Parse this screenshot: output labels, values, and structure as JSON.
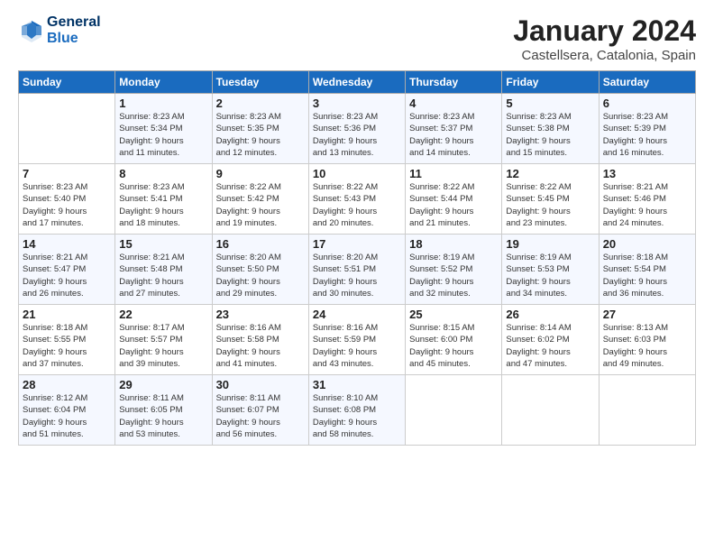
{
  "header": {
    "logo_line1": "General",
    "logo_line2": "Blue",
    "title": "January 2024",
    "subtitle": "Castellsera, Catalonia, Spain"
  },
  "days_of_week": [
    "Sunday",
    "Monday",
    "Tuesday",
    "Wednesday",
    "Thursday",
    "Friday",
    "Saturday"
  ],
  "weeks": [
    [
      {
        "day": "",
        "info": ""
      },
      {
        "day": "1",
        "info": "Sunrise: 8:23 AM\nSunset: 5:34 PM\nDaylight: 9 hours\nand 11 minutes."
      },
      {
        "day": "2",
        "info": "Sunrise: 8:23 AM\nSunset: 5:35 PM\nDaylight: 9 hours\nand 12 minutes."
      },
      {
        "day": "3",
        "info": "Sunrise: 8:23 AM\nSunset: 5:36 PM\nDaylight: 9 hours\nand 13 minutes."
      },
      {
        "day": "4",
        "info": "Sunrise: 8:23 AM\nSunset: 5:37 PM\nDaylight: 9 hours\nand 14 minutes."
      },
      {
        "day": "5",
        "info": "Sunrise: 8:23 AM\nSunset: 5:38 PM\nDaylight: 9 hours\nand 15 minutes."
      },
      {
        "day": "6",
        "info": "Sunrise: 8:23 AM\nSunset: 5:39 PM\nDaylight: 9 hours\nand 16 minutes."
      }
    ],
    [
      {
        "day": "7",
        "info": "Sunrise: 8:23 AM\nSunset: 5:40 PM\nDaylight: 9 hours\nand 17 minutes."
      },
      {
        "day": "8",
        "info": "Sunrise: 8:23 AM\nSunset: 5:41 PM\nDaylight: 9 hours\nand 18 minutes."
      },
      {
        "day": "9",
        "info": "Sunrise: 8:22 AM\nSunset: 5:42 PM\nDaylight: 9 hours\nand 19 minutes."
      },
      {
        "day": "10",
        "info": "Sunrise: 8:22 AM\nSunset: 5:43 PM\nDaylight: 9 hours\nand 20 minutes."
      },
      {
        "day": "11",
        "info": "Sunrise: 8:22 AM\nSunset: 5:44 PM\nDaylight: 9 hours\nand 21 minutes."
      },
      {
        "day": "12",
        "info": "Sunrise: 8:22 AM\nSunset: 5:45 PM\nDaylight: 9 hours\nand 23 minutes."
      },
      {
        "day": "13",
        "info": "Sunrise: 8:21 AM\nSunset: 5:46 PM\nDaylight: 9 hours\nand 24 minutes."
      }
    ],
    [
      {
        "day": "14",
        "info": "Sunrise: 8:21 AM\nSunset: 5:47 PM\nDaylight: 9 hours\nand 26 minutes."
      },
      {
        "day": "15",
        "info": "Sunrise: 8:21 AM\nSunset: 5:48 PM\nDaylight: 9 hours\nand 27 minutes."
      },
      {
        "day": "16",
        "info": "Sunrise: 8:20 AM\nSunset: 5:50 PM\nDaylight: 9 hours\nand 29 minutes."
      },
      {
        "day": "17",
        "info": "Sunrise: 8:20 AM\nSunset: 5:51 PM\nDaylight: 9 hours\nand 30 minutes."
      },
      {
        "day": "18",
        "info": "Sunrise: 8:19 AM\nSunset: 5:52 PM\nDaylight: 9 hours\nand 32 minutes."
      },
      {
        "day": "19",
        "info": "Sunrise: 8:19 AM\nSunset: 5:53 PM\nDaylight: 9 hours\nand 34 minutes."
      },
      {
        "day": "20",
        "info": "Sunrise: 8:18 AM\nSunset: 5:54 PM\nDaylight: 9 hours\nand 36 minutes."
      }
    ],
    [
      {
        "day": "21",
        "info": "Sunrise: 8:18 AM\nSunset: 5:55 PM\nDaylight: 9 hours\nand 37 minutes."
      },
      {
        "day": "22",
        "info": "Sunrise: 8:17 AM\nSunset: 5:57 PM\nDaylight: 9 hours\nand 39 minutes."
      },
      {
        "day": "23",
        "info": "Sunrise: 8:16 AM\nSunset: 5:58 PM\nDaylight: 9 hours\nand 41 minutes."
      },
      {
        "day": "24",
        "info": "Sunrise: 8:16 AM\nSunset: 5:59 PM\nDaylight: 9 hours\nand 43 minutes."
      },
      {
        "day": "25",
        "info": "Sunrise: 8:15 AM\nSunset: 6:00 PM\nDaylight: 9 hours\nand 45 minutes."
      },
      {
        "day": "26",
        "info": "Sunrise: 8:14 AM\nSunset: 6:02 PM\nDaylight: 9 hours\nand 47 minutes."
      },
      {
        "day": "27",
        "info": "Sunrise: 8:13 AM\nSunset: 6:03 PM\nDaylight: 9 hours\nand 49 minutes."
      }
    ],
    [
      {
        "day": "28",
        "info": "Sunrise: 8:12 AM\nSunset: 6:04 PM\nDaylight: 9 hours\nand 51 minutes."
      },
      {
        "day": "29",
        "info": "Sunrise: 8:11 AM\nSunset: 6:05 PM\nDaylight: 9 hours\nand 53 minutes."
      },
      {
        "day": "30",
        "info": "Sunrise: 8:11 AM\nSunset: 6:07 PM\nDaylight: 9 hours\nand 56 minutes."
      },
      {
        "day": "31",
        "info": "Sunrise: 8:10 AM\nSunset: 6:08 PM\nDaylight: 9 hours\nand 58 minutes."
      },
      {
        "day": "",
        "info": ""
      },
      {
        "day": "",
        "info": ""
      },
      {
        "day": "",
        "info": ""
      }
    ]
  ]
}
